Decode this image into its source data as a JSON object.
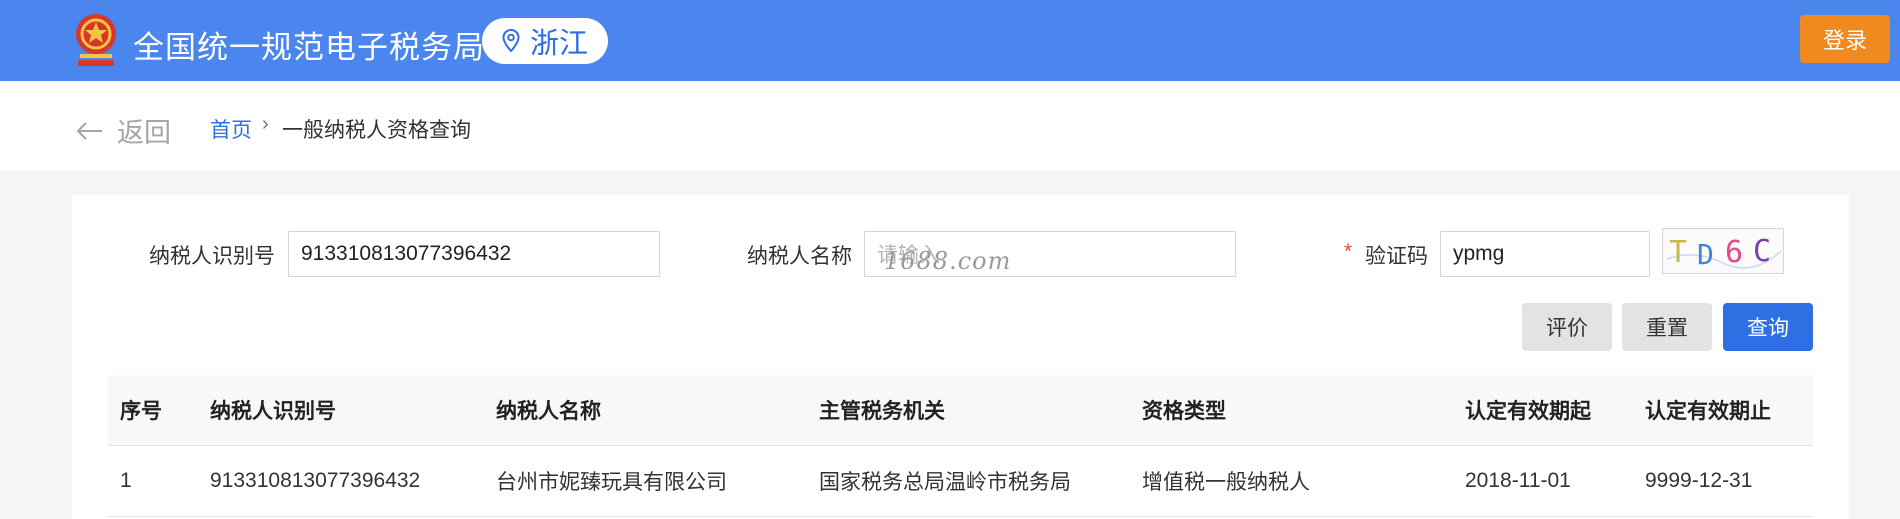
{
  "header": {
    "site_title": "全国统一规范电子税务局",
    "region": "浙江",
    "login_label": "登录",
    "colors": {
      "bar": "#4a86ee",
      "login": "#f08a1e"
    }
  },
  "breadcrumb": {
    "back_label": "返回",
    "home_label": "首页",
    "separator": "›",
    "current_label": "一般纳税人资格查询"
  },
  "form": {
    "taxpayer_id_label": "纳税人识别号",
    "taxpayer_id_value": "913310813077396432",
    "taxpayer_name_label": "纳税人名称",
    "taxpayer_name_placeholder": "请输入",
    "captcha_required_mark": "*",
    "captcha_label": "验证码",
    "captcha_value": "ypmg",
    "captcha_image_text": "TD6C",
    "watermark": "1688.com"
  },
  "actions": {
    "evaluate_label": "评价",
    "reset_label": "重置",
    "query_label": "查询"
  },
  "table": {
    "columns": [
      "序号",
      "纳税人识别号",
      "纳税人名称",
      "主管税务机关",
      "资格类型",
      "认定有效期起",
      "认定有效期止"
    ],
    "rows": [
      [
        "1",
        "913310813077396432",
        "台州市妮臻玩具有限公司",
        "国家税务总局温岭市税务局",
        "增值税一般纳税人",
        "2018-11-01",
        "9999-12-31"
      ]
    ]
  }
}
